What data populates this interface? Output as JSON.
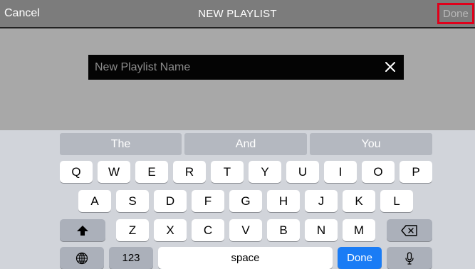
{
  "navbar": {
    "cancel_label": "Cancel",
    "title": "NEW PLAYLIST",
    "done_label": "Done"
  },
  "name_field": {
    "placeholder": "New Playlist Name",
    "value": "",
    "clear_icon": "close-icon"
  },
  "keyboard": {
    "suggestions": [
      "The",
      "And",
      "You"
    ],
    "row1": [
      "Q",
      "W",
      "E",
      "R",
      "T",
      "Y",
      "U",
      "I",
      "O",
      "P"
    ],
    "row2": [
      "A",
      "S",
      "D",
      "F",
      "G",
      "H",
      "J",
      "K",
      "L"
    ],
    "row3": [
      "Z",
      "X",
      "C",
      "V",
      "B",
      "N",
      "M"
    ],
    "shift_icon": "shift-arrow-icon",
    "delete_icon": "backspace-icon",
    "globe_icon": "globe-icon",
    "numbers_label": "123",
    "space_label": "space",
    "return_label": "Done",
    "mic_icon": "microphone-icon"
  },
  "colors": {
    "highlight_border": "#e0001b",
    "done_key": "#1a7cf5",
    "navbar": "#7c7c7c",
    "backdrop": "#a8a8a8"
  }
}
